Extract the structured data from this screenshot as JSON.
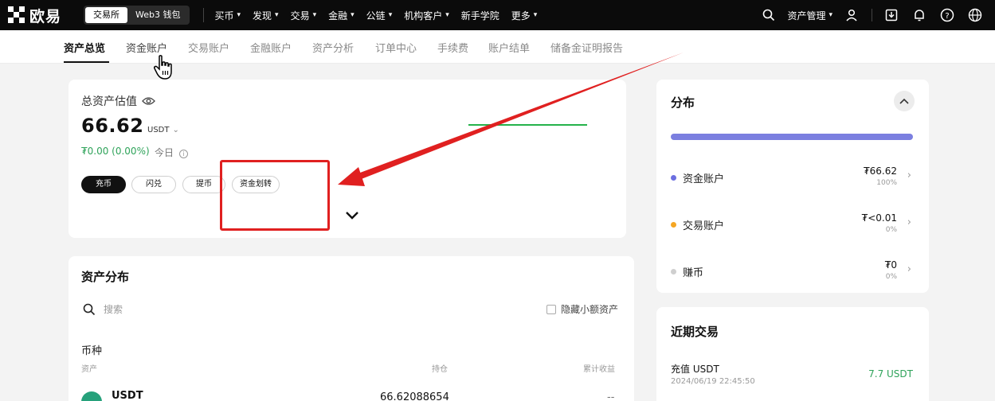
{
  "topbar": {
    "brand": "欧易",
    "modes": [
      "交易所",
      "Web3 钱包"
    ],
    "nav": [
      {
        "label": "买币",
        "dropdown": true
      },
      {
        "label": "发现",
        "dropdown": true
      },
      {
        "label": "交易",
        "dropdown": true
      },
      {
        "label": "金融",
        "dropdown": true
      },
      {
        "label": "公链",
        "dropdown": true
      },
      {
        "label": "机构客户",
        "dropdown": true
      },
      {
        "label": "新手学院",
        "dropdown": false
      },
      {
        "label": "更多",
        "dropdown": true
      }
    ],
    "asset_manage": "资产管理"
  },
  "subtabs": [
    "资产总览",
    "资金账户",
    "交易账户",
    "金融账户",
    "资产分析",
    "订单中心",
    "手续费",
    "账户结单",
    "储备金证明报告"
  ],
  "overview": {
    "title": "总资产估值",
    "value": "66.62",
    "unit": "USDT",
    "change": "₮0.00 (0.00%)",
    "today": "今日",
    "actions": [
      "充币",
      "闪兑",
      "提币",
      "资金划转"
    ]
  },
  "asset_dist": {
    "title": "资产分布",
    "search_placeholder": "搜索",
    "hide_small": "隐藏小额资产",
    "coin_header": "币种",
    "columns": [
      "资产",
      "持仓",
      "累计收益"
    ],
    "rows": [
      {
        "coin": "USDT",
        "holding": "66.62088654",
        "pnl": "--"
      }
    ]
  },
  "distribution": {
    "title": "分布",
    "bar_color": "#7b7fe0",
    "items": [
      {
        "name": "资金账户",
        "value": "₮66.62",
        "pct": "100%",
        "color": "#6c6fe0"
      },
      {
        "name": "交易账户",
        "value": "₮<0.01",
        "pct": "0%",
        "color": "#f5a623"
      },
      {
        "name": "赚币",
        "value": "₮0",
        "pct": "0%",
        "color": "#cfcfcf"
      }
    ]
  },
  "recent": {
    "title": "近期交易",
    "items": [
      {
        "title": "充值 USDT",
        "time": "2024/06/19 22:45:50",
        "amount": "7.7 USDT"
      }
    ]
  },
  "colors": {
    "positive": "#2fa35a",
    "annotation": "#e02020"
  }
}
